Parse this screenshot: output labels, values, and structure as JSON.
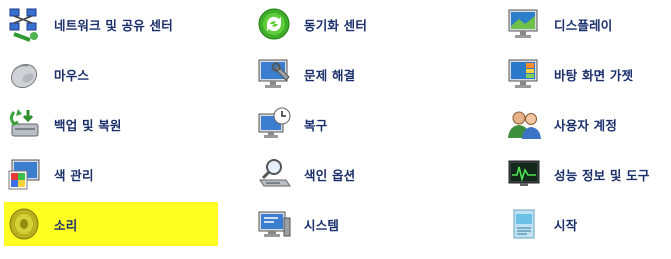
{
  "control_panel": {
    "items": [
      {
        "label": "네트워크 및 공유 센터",
        "icon": "network-sharing-icon"
      },
      {
        "label": "동기화 센터",
        "icon": "sync-center-icon"
      },
      {
        "label": "디스플레이",
        "icon": "display-icon"
      },
      {
        "label": "마우스",
        "icon": "mouse-icon"
      },
      {
        "label": "문제 해결",
        "icon": "troubleshooting-icon"
      },
      {
        "label": "바탕 화면 가젯",
        "icon": "desktop-gadgets-icon"
      },
      {
        "label": "백업 및 복원",
        "icon": "backup-restore-icon"
      },
      {
        "label": "복구",
        "icon": "recovery-icon"
      },
      {
        "label": "사용자 계정",
        "icon": "user-accounts-icon"
      },
      {
        "label": "색 관리",
        "icon": "color-management-icon"
      },
      {
        "label": "색인 옵션",
        "icon": "indexing-options-icon"
      },
      {
        "label": "성능 정보 및 도구",
        "icon": "performance-tools-icon"
      },
      {
        "label": "소리",
        "icon": "sound-icon",
        "highlighted": true
      },
      {
        "label": "시스템",
        "icon": "system-icon"
      },
      {
        "label": "시작",
        "icon": "getting-started-icon"
      }
    ]
  },
  "colors": {
    "label_text": "#1a2f6b",
    "highlight": "#ffff22"
  }
}
